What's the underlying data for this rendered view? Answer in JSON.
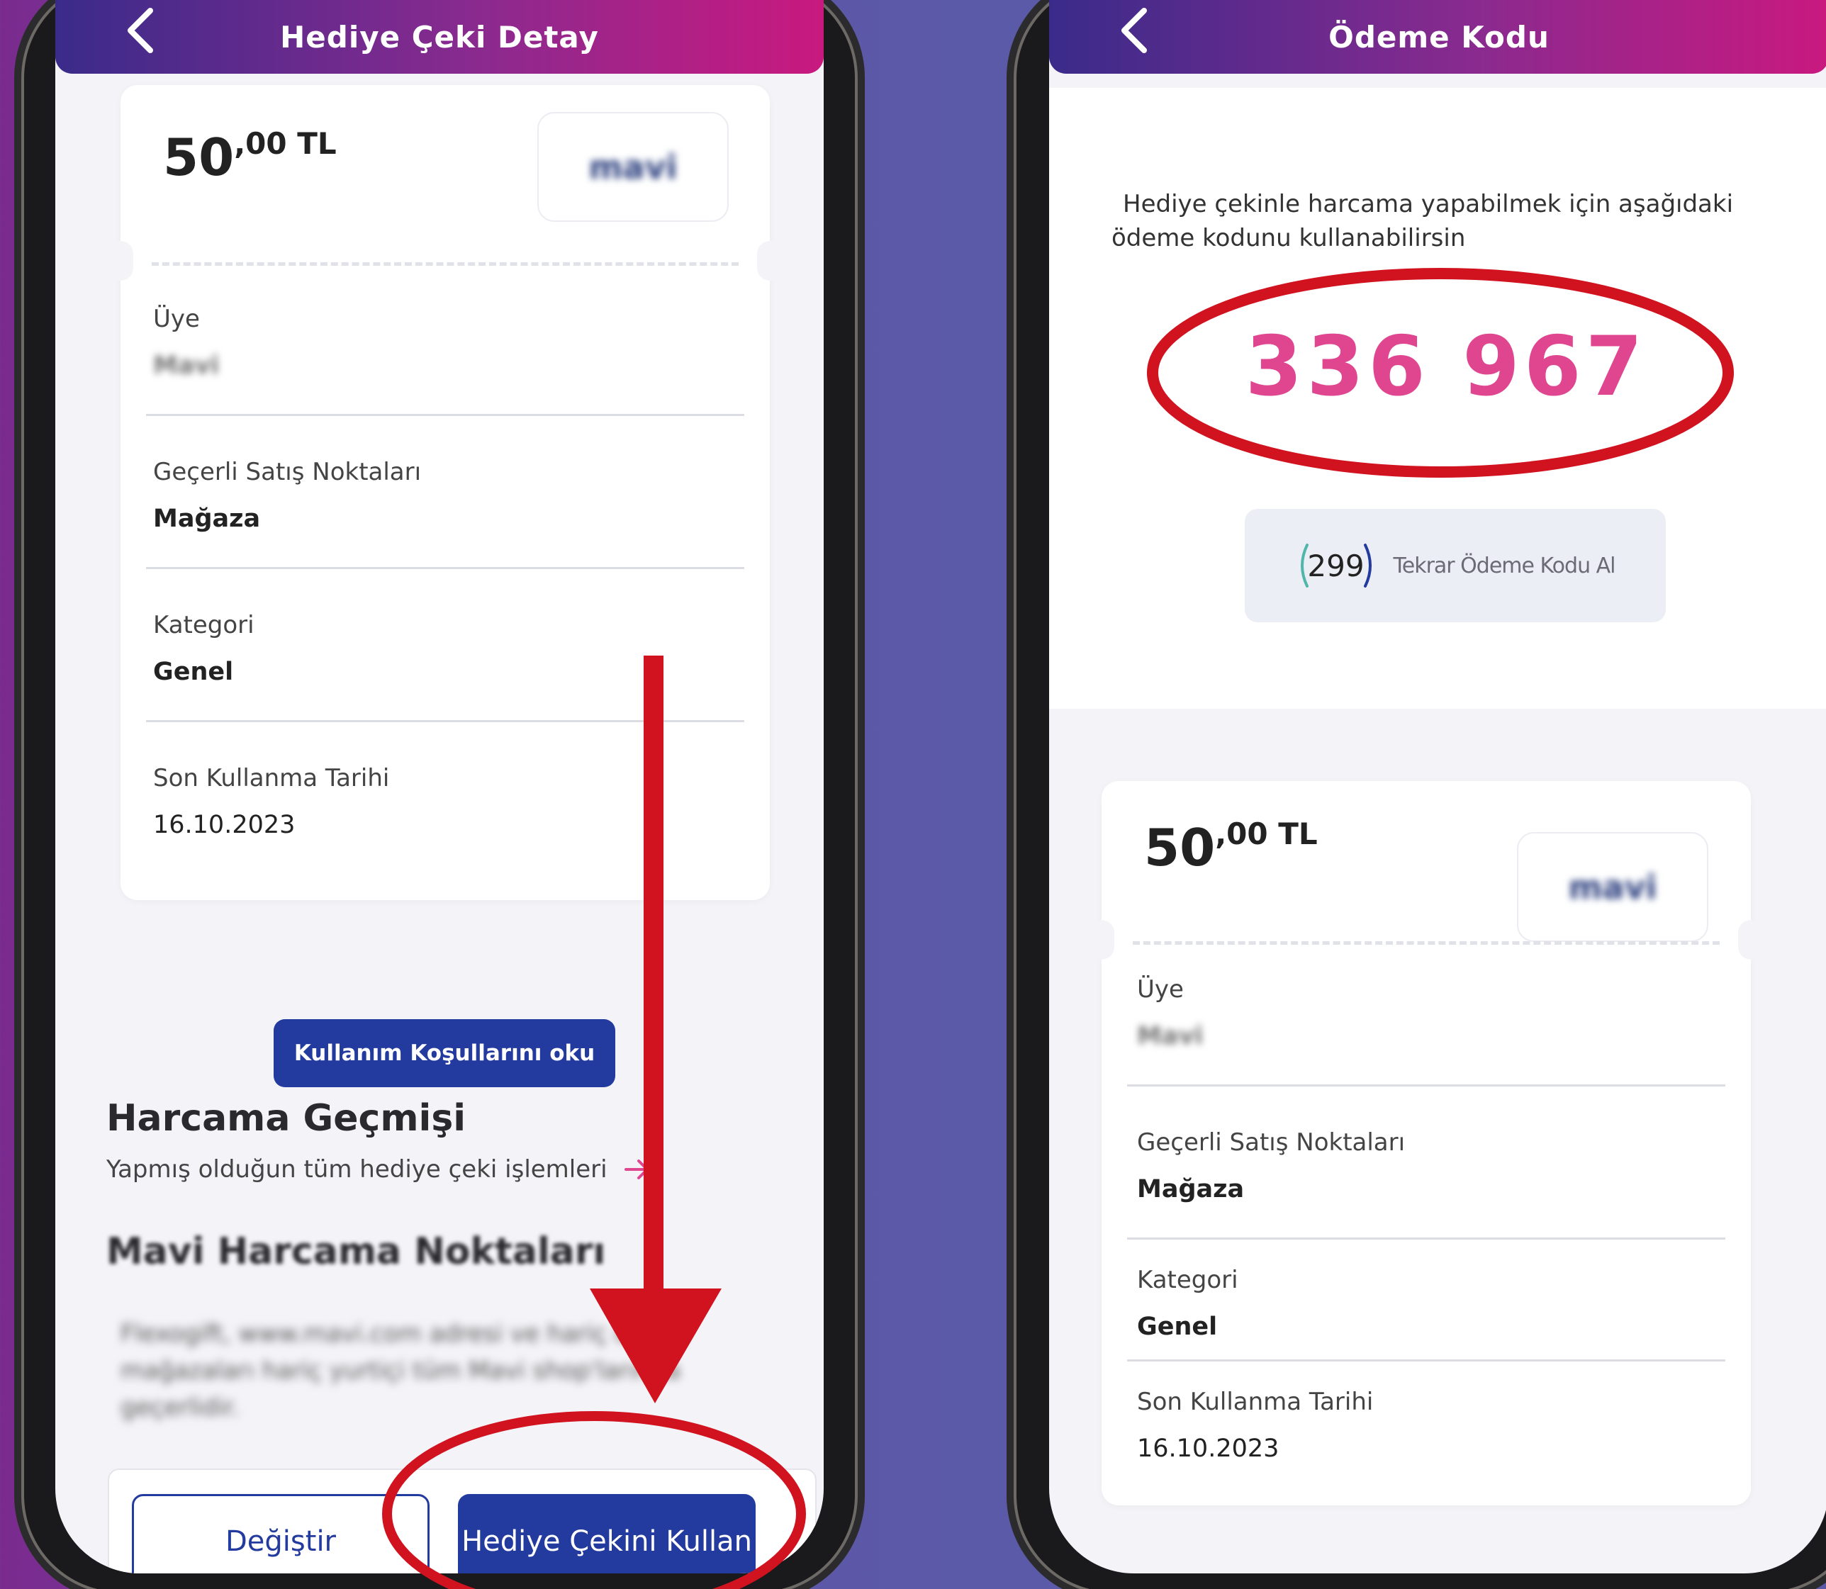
{
  "left_screen": {
    "header": {
      "title": "Hediye Çeki Detay"
    },
    "voucher": {
      "amount_main": "50",
      "amount_decimal": ",00 TL",
      "brand_logo_text": "mavi"
    },
    "fields": [
      {
        "label": "Üye",
        "value": "Mavi"
      },
      {
        "label": "Geçerli Satış Noktaları",
        "value": "Mağaza"
      },
      {
        "label": "Kategori",
        "value": "Genel"
      },
      {
        "label": "Son Kullanma Tarihi",
        "value": "16.10.2023"
      }
    ],
    "terms_button": "Kullanım Koşullarını oku",
    "history": {
      "title": "Harcama Geçmişi",
      "subtitle": "Yapmış olduğun tüm hediye çeki işlemleri"
    },
    "points": {
      "title": "Mavi Harcama Noktaları",
      "body_line1": "Flexogift, www.mavi.com adresi ve hariç outlet",
      "body_line2": "mağazaları hariç yurtiçi tüm Mavi shop'larında",
      "body_line3": "geçerlidir."
    },
    "actions": {
      "change": "Değiştir",
      "use": "Hediye Çekini Kullan"
    }
  },
  "right_screen": {
    "header": {
      "title": "Ödeme Kodu"
    },
    "info_line1": "Hediye çekinle harcama yapabilmek için aşağıdaki",
    "info_line2": "ödeme kodunu kullanabilirsin",
    "payment_code": "336 967",
    "timer": {
      "seconds": "299",
      "label": "Tekrar Ödeme Kodu Al"
    },
    "voucher": {
      "amount_main": "50",
      "amount_decimal": ",00 TL",
      "brand_logo_text": "mavi"
    },
    "fields": [
      {
        "label": "Üye",
        "value": "Mavi"
      },
      {
        "label": "Geçerli Satış Noktaları",
        "value": "Mağaza"
      },
      {
        "label": "Kategori",
        "value": "Genel"
      },
      {
        "label": "Son Kullanma Tarihi",
        "value": "16.10.2023"
      }
    ]
  },
  "colors": {
    "brand_blue": "#233a9e",
    "code_pink": "#e0468f",
    "annotation_red": "#d1121f"
  }
}
